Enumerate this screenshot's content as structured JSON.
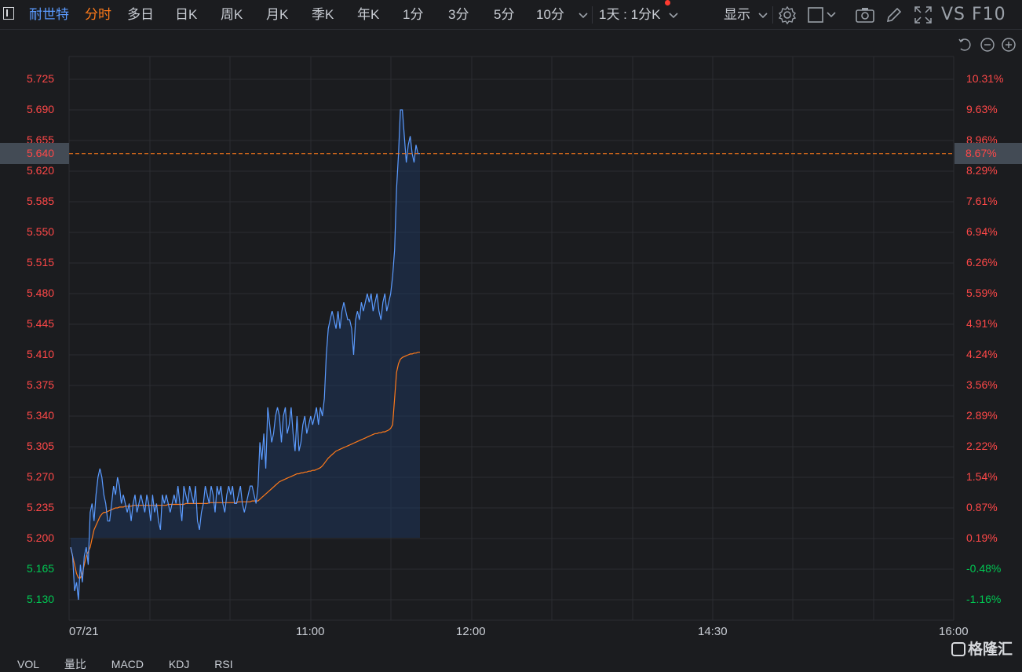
{
  "toolbar": {
    "stock_name": "耐世特",
    "tabs": [
      "分时",
      "多日",
      "日K",
      "周K",
      "月K",
      "季K",
      "年K",
      "1分",
      "3分",
      "5分",
      "10分"
    ],
    "period_select": "1天 : 1分K",
    "display_label": "显示",
    "vs_f10": "VS F10"
  },
  "axis": {
    "left": [
      "5.725",
      "5.690",
      "5.655",
      "5.620",
      "5.585",
      "5.550",
      "5.515",
      "5.480",
      "5.445",
      "5.410",
      "5.375",
      "5.340",
      "5.305",
      "5.270",
      "5.235",
      "5.200",
      "5.165",
      "5.130"
    ],
    "right": [
      "10.31%",
      "9.63%",
      "8.96%",
      "8.29%",
      "7.61%",
      "6.94%",
      "6.26%",
      "5.59%",
      "4.91%",
      "4.24%",
      "3.56%",
      "2.89%",
      "2.22%",
      "1.54%",
      "0.87%",
      "0.19%",
      "-0.48%",
      "-1.16%"
    ],
    "times": [
      "07/21",
      "11:00",
      "12:00",
      "14:30",
      "16:00"
    ]
  },
  "current_price": "5.640",
  "current_pct": "8.67%",
  "bottom_tabs": [
    "VOL",
    "量比",
    "MACD",
    "KDJ",
    "RSI"
  ],
  "watermark": "格隆汇",
  "colors": {
    "price_line": "#5b9bff",
    "avg_line": "#ff7a1a",
    "up": "#ff4848",
    "down": "#00c853",
    "toolbar_active": "#ff7a1a",
    "stock_name": "#5b9bff"
  },
  "chart_data": {
    "type": "line",
    "title": "",
    "price_range": [
      5.13,
      5.725
    ],
    "x_labels": [
      "07/21",
      "11:00",
      "12:00",
      "14:30",
      "16:00"
    ],
    "series": [
      {
        "values": [
          5.19,
          5.18,
          5.14,
          5.15,
          5.13,
          5.17,
          5.15,
          5.18,
          5.19,
          5.17,
          5.23,
          5.24,
          5.22,
          5.25,
          5.27,
          5.28,
          5.27,
          5.25,
          5.24,
          5.22,
          5.22,
          5.24,
          5.26,
          5.25,
          5.27,
          5.26,
          5.24,
          5.25,
          5.24,
          5.23,
          5.24,
          5.22,
          5.24,
          5.25,
          5.23,
          5.24,
          5.25,
          5.24,
          5.23,
          5.25,
          5.24,
          5.22,
          5.25,
          5.23,
          5.24,
          5.22,
          5.21,
          5.25,
          5.24,
          5.25,
          5.24,
          5.23,
          5.24,
          5.25,
          5.24,
          5.26,
          5.24,
          5.22,
          5.26,
          5.25,
          5.24,
          5.26,
          5.25,
          5.24,
          5.26,
          5.22,
          5.21,
          5.23,
          5.24,
          5.26,
          5.25,
          5.24,
          5.26,
          5.25,
          5.23,
          5.26,
          5.25,
          5.26,
          5.24,
          5.23,
          5.25,
          5.26,
          5.25,
          5.26,
          5.24,
          5.24,
          5.25,
          5.26,
          5.24,
          5.23,
          5.24,
          5.25,
          5.26,
          5.26,
          5.25,
          5.24,
          5.26,
          5.31,
          5.29,
          5.32,
          5.28,
          5.35,
          5.33,
          5.31,
          5.32,
          5.34,
          5.35,
          5.34,
          5.31,
          5.34,
          5.35,
          5.32,
          5.33,
          5.35,
          5.32,
          5.3,
          5.34,
          5.3,
          5.31,
          5.33,
          5.34,
          5.32,
          5.33,
          5.34,
          5.33,
          5.34,
          5.35,
          5.33,
          5.35,
          5.34,
          5.36,
          5.41,
          5.44,
          5.45,
          5.46,
          5.45,
          5.44,
          5.46,
          5.44,
          5.46,
          5.47,
          5.46,
          5.45,
          5.45,
          5.44,
          5.41,
          5.45,
          5.46,
          5.45,
          5.47,
          5.46,
          5.47,
          5.48,
          5.47,
          5.48,
          5.46,
          5.47,
          5.48,
          5.46,
          5.45,
          5.47,
          5.48,
          5.46,
          5.47,
          5.48,
          5.5,
          5.53,
          5.6,
          5.64,
          5.69,
          5.69,
          5.66,
          5.63,
          5.65,
          5.66,
          5.64,
          5.63,
          5.65,
          5.64,
          5.64
        ],
        "x_start": 0,
        "x_step": 1
      },
      {
        "values": [
          5.19,
          5.18,
          5.17,
          5.16,
          5.155,
          5.155,
          5.16,
          5.17,
          5.18,
          5.185,
          5.19,
          5.2,
          5.21,
          5.215,
          5.22,
          5.225,
          5.228,
          5.23,
          5.23,
          5.231,
          5.232,
          5.233,
          5.234,
          5.235,
          5.235,
          5.236,
          5.236,
          5.236,
          5.237,
          5.237,
          5.237,
          5.237,
          5.238,
          5.238,
          5.238,
          5.238,
          5.238,
          5.238,
          5.238,
          5.238,
          5.238,
          5.238,
          5.238,
          5.238,
          5.238,
          5.238,
          5.238,
          5.238,
          5.238,
          5.238,
          5.239,
          5.239,
          5.239,
          5.239,
          5.239,
          5.239,
          5.239,
          5.239,
          5.239,
          5.24,
          5.24,
          5.24,
          5.24,
          5.24,
          5.24,
          5.24,
          5.24,
          5.24,
          5.24,
          5.24,
          5.24,
          5.241,
          5.241,
          5.241,
          5.241,
          5.241,
          5.241,
          5.241,
          5.241,
          5.241,
          5.241,
          5.241,
          5.241,
          5.241,
          5.241,
          5.241,
          5.242,
          5.242,
          5.242,
          5.242,
          5.242,
          5.242,
          5.242,
          5.243,
          5.243,
          5.243,
          5.243,
          5.245,
          5.247,
          5.249,
          5.251,
          5.253,
          5.255,
          5.257,
          5.259,
          5.261,
          5.263,
          5.265,
          5.266,
          5.267,
          5.268,
          5.269,
          5.27,
          5.271,
          5.272,
          5.273,
          5.274,
          5.274,
          5.275,
          5.275,
          5.276,
          5.276,
          5.277,
          5.277,
          5.278,
          5.278,
          5.279,
          5.28,
          5.281,
          5.283,
          5.286,
          5.289,
          5.292,
          5.294,
          5.296,
          5.298,
          5.3,
          5.301,
          5.302,
          5.303,
          5.304,
          5.305,
          5.306,
          5.307,
          5.308,
          5.309,
          5.31,
          5.311,
          5.312,
          5.313,
          5.314,
          5.315,
          5.316,
          5.317,
          5.318,
          5.319,
          5.32,
          5.32,
          5.321,
          5.321,
          5.322,
          5.322,
          5.323,
          5.324,
          5.326,
          5.33,
          5.36,
          5.39,
          5.4,
          5.405,
          5.407,
          5.408,
          5.409,
          5.41,
          5.411,
          5.411,
          5.412,
          5.412,
          5.413,
          5.413
        ],
        "x_start": 0,
        "x_step": 1
      }
    ],
    "ylabel": "",
    "xlabel": "",
    "grid": true,
    "reference_line": 5.64
  }
}
